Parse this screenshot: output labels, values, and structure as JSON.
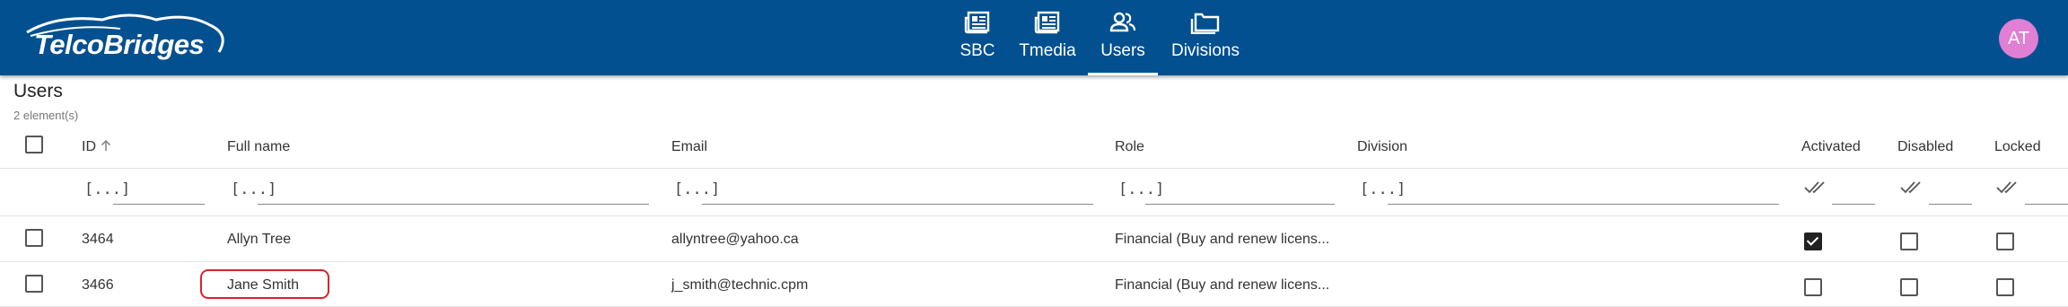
{
  "app": {
    "logo_text": "TelcoBridges"
  },
  "nav": {
    "items": [
      {
        "label": "SBC",
        "icon": "newspaper-icon"
      },
      {
        "label": "Tmedia",
        "icon": "newspaper-icon"
      },
      {
        "label": "Users",
        "icon": "users-icon",
        "active": true
      },
      {
        "label": "Divisions",
        "icon": "folder-icon"
      }
    ]
  },
  "user": {
    "initials": "AT"
  },
  "page": {
    "title": "Users",
    "count": "2 element(s)"
  },
  "table": {
    "columns": {
      "id": "ID",
      "full_name": "Full name",
      "email": "Email",
      "role": "Role",
      "division": "Division",
      "activated": "Activated",
      "disabled": "Disabled",
      "locked": "Locked"
    },
    "filter_placeholder": "[...]",
    "rows": [
      {
        "id": "3464",
        "full_name": "Allyn Tree",
        "email": "allyntree@yahoo.ca",
        "role": "Financial (Buy and renew licens...",
        "division": "",
        "activated": true,
        "disabled": false,
        "locked": false
      },
      {
        "id": "3466",
        "full_name": "Jane Smith",
        "email": "j_smith@technic.cpm",
        "role": "Financial (Buy and renew licens...",
        "division": "",
        "activated": false,
        "disabled": false,
        "locked": false
      }
    ]
  },
  "colors": {
    "topbar": "#02508f",
    "avatar": "#e07fd3",
    "highlight": "#d8232a"
  }
}
